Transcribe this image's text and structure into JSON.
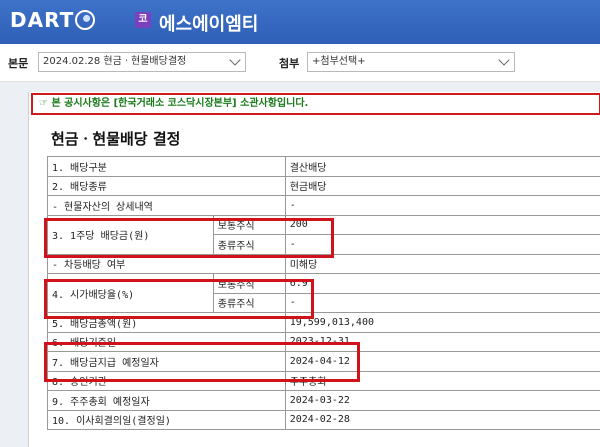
{
  "app": {
    "logo_text": "DART",
    "market_badge": "코",
    "company_name": "에스에이엠티"
  },
  "toolbar": {
    "main_label": "본문",
    "main_select_value": "2024.02.28  현금ㆍ현물배당결정",
    "attach_label": "첨부",
    "attach_select_value": "+첨부선택+"
  },
  "document": {
    "notice": "☞ 본 공시사항은 [한국거래소 코스닥시장본부] 소관사항입니다.",
    "title": "현금ㆍ현물배당 결정",
    "rows": [
      {
        "label": "1. 배당구분",
        "value": "결산배당"
      },
      {
        "label": "2. 배당종류",
        "value": "현금배당"
      },
      {
        "label": "- 현물자산의 상세내역",
        "value": "-"
      },
      {
        "label": "3. 1주당 배당금(원)",
        "sub1": "보통주식",
        "val1": "200",
        "sub2": "종류주식",
        "val2": "-"
      },
      {
        "label": "- 차등배당 여부",
        "value": "미해당"
      },
      {
        "label": "4. 시가배당율(%)",
        "sub1": "보통주식",
        "val1": "6.9",
        "sub2": "종류주식",
        "val2": "-"
      },
      {
        "label": "5. 배당금총액(원)",
        "value": "19,599,013,400"
      },
      {
        "label": "6. 배당기준일",
        "value": "2023-12-31"
      },
      {
        "label": "7. 배당금지급 예정일자",
        "value": "2024-04-12"
      },
      {
        "label": "8. 승인기관",
        "value": "주주총회"
      },
      {
        "label": "9. 주주총회 예정일자",
        "value": "2024-03-22"
      },
      {
        "label": "10. 이사회결의일(결정일)",
        "value": "2024-02-28"
      }
    ]
  }
}
